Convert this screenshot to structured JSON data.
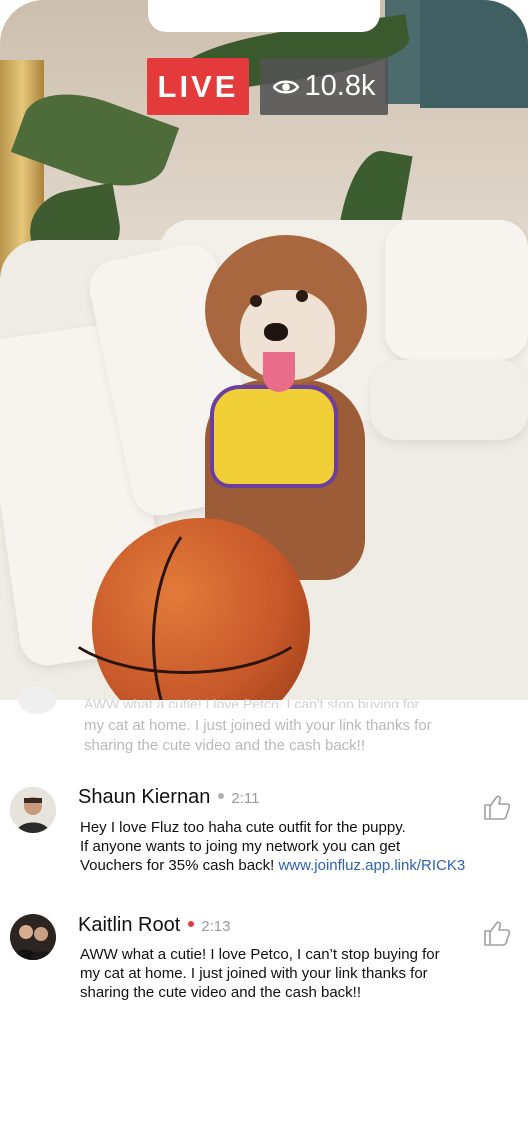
{
  "stream": {
    "live_label": "LIVE",
    "viewer_count": "10.8k",
    "live_color": "#e43a3b"
  },
  "faded_comment": {
    "top_text": "AWW what a cutie! I love Petco, I can't stop buying for",
    "lines": [
      "my cat at home. I just joined with your link thanks for",
      "sharing the cute video and the cash back!!"
    ]
  },
  "comments": [
    {
      "name": "Shaun Kiernan",
      "status_dot_color": "#b0b0b0",
      "time": "2:11",
      "lines": [
        "Hey I love Fluz too haha cute outfit for the puppy.",
        "If anyone wants to joing my network you can get"
      ],
      "last_line_prefix": "Vouchers for 35% cash back! ",
      "link": "www.joinfluz.app.link/RICK3",
      "like_icon": "thumbs-up-icon"
    },
    {
      "name": "Kaitlin Root",
      "status_dot_color": "#e43a3b",
      "time": "2:13",
      "lines": [
        "AWW what a cutie! I love Petco, I can’t stop buying for",
        "my cat at home. I just joined with your link thanks for",
        "sharing the cute video and the cash back!!"
      ],
      "like_icon": "thumbs-up-icon"
    }
  ]
}
